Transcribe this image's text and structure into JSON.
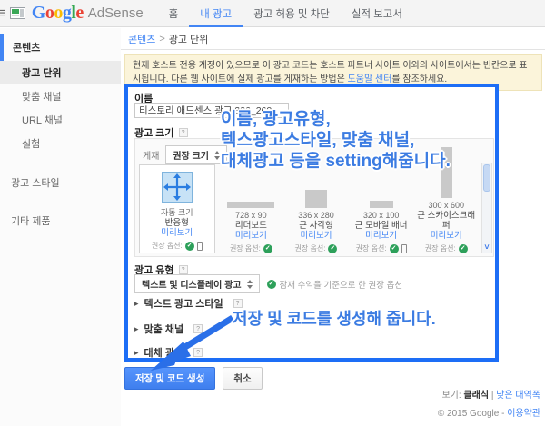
{
  "header": {
    "logo": {
      "letters": [
        "G",
        "o",
        "o",
        "g",
        "l",
        "e"
      ],
      "letter_colors": [
        "#4285f4",
        "#ea4335",
        "#fbbc05",
        "#4285f4",
        "#34a853",
        "#ea4335"
      ],
      "adsense": "AdSense"
    },
    "nav": [
      {
        "label": "홈"
      },
      {
        "label": "내 광고"
      },
      {
        "label": "광고 허용 및 차단"
      },
      {
        "label": "실적 보고서"
      }
    ]
  },
  "sidebar": {
    "section_label": "콘텐츠",
    "items": [
      {
        "label": "광고 단위"
      },
      {
        "label": "맞춤 채널"
      },
      {
        "label": "URL 채널"
      },
      {
        "label": "실험"
      }
    ],
    "extra_items": [
      {
        "label": "광고 스타일"
      },
      {
        "label": "기타 제품"
      }
    ]
  },
  "breadcrumb": {
    "parent": "콘텐츠",
    "separator": ">",
    "current": "광고 단위"
  },
  "notice": {
    "text_before": "현재 호스트 전용 계정이 있으므로 이 광고 코드는 호스트 파트너 사이트 이외의 사이트에서는 빈칸으로 표시됩니다. 다른 웹 사이트에 실제 광고를 게재하는 방법은 ",
    "link_label": "도움말 센터",
    "text_after": "를 참조하세요."
  },
  "form": {
    "name": {
      "label": "이름",
      "value": "티스토리 애드센스 광고 336_260"
    },
    "ad_size": {
      "label": "광고 크기",
      "display_label": "게재",
      "sort_dropdown": "권장 크기",
      "options": [
        {
          "line1": "자동 크기",
          "line2": "반응형",
          "preview": "미리보기",
          "recommend_label": "권장 옵션:"
        },
        {
          "line1": "728 x 90",
          "line2": "리더보드",
          "preview": "미리보기",
          "recommend_label": "권장 옵션:"
        },
        {
          "line1": "336 x 280",
          "line2": "큰 사각형",
          "preview": "미리보기",
          "recommend_label": "권장 옵션:"
        },
        {
          "line1": "320 x 100",
          "line2": "큰 모바일 배너",
          "preview": "미리보기",
          "recommend_label": "권장 옵션:"
        },
        {
          "line1": "300 x 600",
          "line2": "큰 스카이스크래퍼",
          "preview": "미리보기",
          "recommend_label": "권장 옵션:"
        }
      ]
    },
    "ad_type": {
      "label": "광고 유형",
      "dropdown_value": "텍스트 및 디스플레이 광고",
      "hint": "잠재 수익을 기준으로 한 권장 옵션"
    },
    "collapsed_sections": [
      {
        "label": "텍스트 광고 스타일"
      },
      {
        "label": "맞춤 채널"
      },
      {
        "label": "대체 광고"
      }
    ],
    "buttons": {
      "save": "저장 및 코드 생성",
      "cancel": "취소"
    }
  },
  "annotations": {
    "setting_lines": [
      "이름, 광고유형,",
      "텍스광고스타일, 맞춤 채널,",
      "대체광고 등을 setting해줍니다."
    ],
    "save_note": "저장 및 코드를 생성해 줍니다."
  },
  "footer": {
    "view_label": "보기:",
    "view_current": "클래식",
    "separator": "|",
    "view_alt": "낮은 대역폭",
    "copyright": "© 2015 Google -",
    "terms": "이용약관"
  },
  "icons": {
    "hamburger": "≡",
    "help": "?",
    "check": "✓",
    "collapse_arrow": "▸",
    "scroll_down": "˅"
  },
  "colors": {
    "accent_blue": "#4285f4",
    "annotation_blue": "#3c7ce2",
    "annotation_border": "#1d6ef6",
    "notice_bg": "#fbf4da",
    "check_green": "#2da05a"
  }
}
